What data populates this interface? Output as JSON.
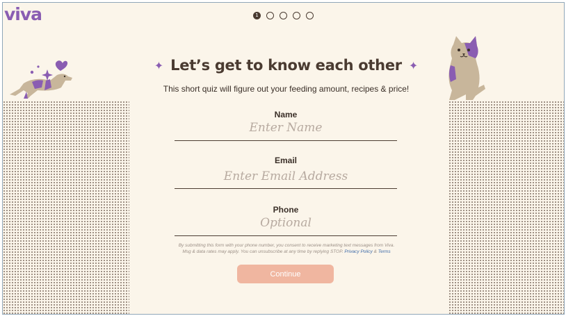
{
  "brand": {
    "logo_text": "viva",
    "color": "#8a5db2"
  },
  "progress": {
    "current_step": 1,
    "total_steps": 5,
    "active_label": "1"
  },
  "quiz": {
    "title": "Let’s get to know each other",
    "subtitle": "This short quiz will figure out your feeding amount, recipes & price!",
    "fields": [
      {
        "label": "Name",
        "placeholder": "Enter Name",
        "value": ""
      },
      {
        "label": "Email",
        "placeholder": "Enter Email Address",
        "value": ""
      },
      {
        "label": "Phone",
        "placeholder": "Optional",
        "value": ""
      }
    ],
    "disclaimer_text": "By submitting this form with your phone number, you consent to receive marketing text messages from Viva. Msg & data rates may apply. You can unsubscribe at any time by replying STOP.",
    "privacy_link": "Privacy Policy",
    "and_text": "&",
    "terms_link": "Terms",
    "continue_label": "Continue"
  },
  "colors": {
    "background": "#fbf5ea",
    "text": "#4a3b31",
    "button": "#f0b6a0"
  },
  "icons": {
    "sparkle": "four-point-star",
    "dog": "dachshund-illustration",
    "cat": "cat-illustration"
  }
}
